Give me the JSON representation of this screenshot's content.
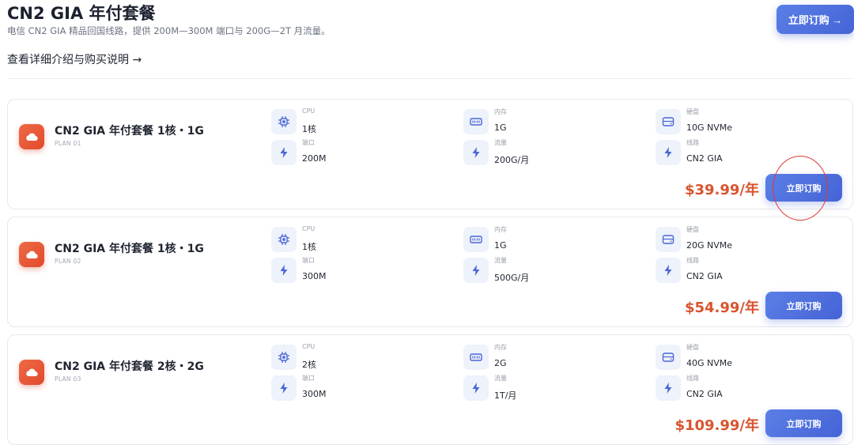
{
  "header": {
    "title": "CN2 GIA 年付套餐",
    "subtitle": "电信 CN2 GIA 精品回国线路，提供 200M—300M 端口与 200G—2T 月流量。",
    "detail_link": "查看详细介绍与购买说明 →",
    "order_label": "立即订购 →"
  },
  "colors": {
    "accent": "#4f6fe0",
    "price": "#d9542f",
    "icon_bg": "#e35432"
  },
  "plans": [
    {
      "name": "CN2 GIA 年付套餐 1核・1G",
      "code": "PLAN 01",
      "specs": {
        "cpu_label": "CPU",
        "cpu": "1核",
        "mem_label": "内存",
        "mem": "1G",
        "disk_label": "硬盘",
        "disk": "10G NVMe",
        "port_label": "端口",
        "port": "200M",
        "traffic_label": "流量",
        "traffic": "200G/月",
        "route_label": "线路",
        "route": "CN2 GIA"
      },
      "price": "$39.99/年",
      "order_label": "立即订购"
    },
    {
      "name": "CN2 GIA 年付套餐 1核・1G",
      "code": "PLAN 02",
      "specs": {
        "cpu_label": "CPU",
        "cpu": "1核",
        "mem_label": "内存",
        "mem": "1G",
        "disk_label": "硬盘",
        "disk": "20G NVMe",
        "port_label": "端口",
        "port": "300M",
        "traffic_label": "流量",
        "traffic": "500G/月",
        "route_label": "线路",
        "route": "CN2 GIA"
      },
      "price": "$54.99/年",
      "order_label": "立即订购"
    },
    {
      "name": "CN2 GIA 年付套餐 2核・2G",
      "code": "PLAN 03",
      "specs": {
        "cpu_label": "CPU",
        "cpu": "2核",
        "mem_label": "内存",
        "mem": "2G",
        "disk_label": "硬盘",
        "disk": "40G NVMe",
        "port_label": "端口",
        "port": "300M",
        "traffic_label": "流量",
        "traffic": "1T/月",
        "route_label": "线路",
        "route": "CN2 GIA"
      },
      "price": "$109.99/年",
      "order_label": "立即订购"
    }
  ],
  "icons": [
    "cloud-icon",
    "cpu-icon",
    "memory-icon",
    "disk-icon",
    "bolt-icon"
  ]
}
